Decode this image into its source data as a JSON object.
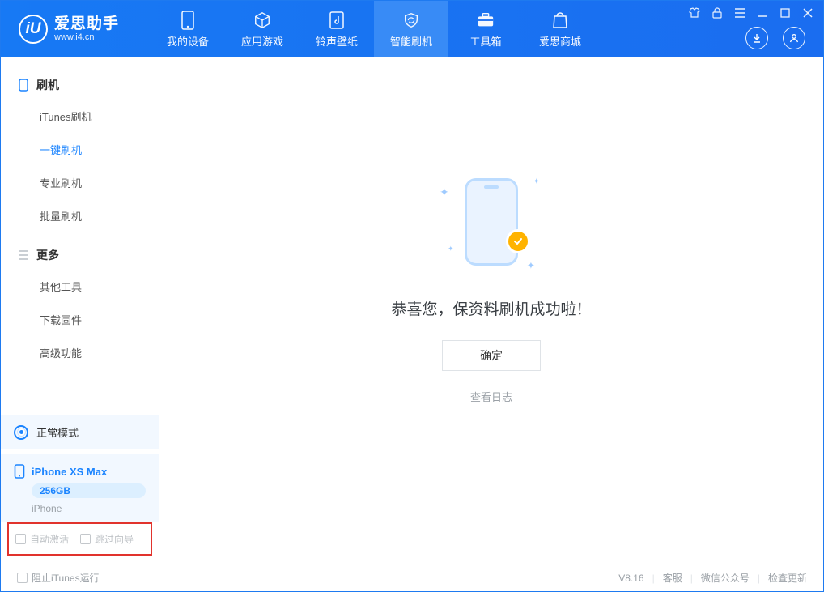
{
  "brand": {
    "name": "爱思助手",
    "url": "www.i4.cn",
    "logo_letter": "iU"
  },
  "nav": {
    "tabs": [
      {
        "label": "我的设备"
      },
      {
        "label": "应用游戏"
      },
      {
        "label": "铃声壁纸"
      },
      {
        "label": "智能刷机"
      },
      {
        "label": "工具箱"
      },
      {
        "label": "爱思商城"
      }
    ]
  },
  "sidebar": {
    "section_flash": "刷机",
    "items_flash": [
      {
        "label": "iTunes刷机"
      },
      {
        "label": "一键刷机"
      },
      {
        "label": "专业刷机"
      },
      {
        "label": "批量刷机"
      }
    ],
    "section_more": "更多",
    "items_more": [
      {
        "label": "其他工具"
      },
      {
        "label": "下载固件"
      },
      {
        "label": "高级功能"
      }
    ],
    "mode_label": "正常模式",
    "device": {
      "name": "iPhone XS Max",
      "storage": "256GB",
      "platform": "iPhone"
    },
    "chk_auto_activate": "自动激活",
    "chk_skip_guide": "跳过向导"
  },
  "main": {
    "success_title": "恭喜您，保资料刷机成功啦！",
    "ok_label": "确定",
    "log_link": "查看日志"
  },
  "status": {
    "block_itunes": "阻止iTunes运行",
    "version": "V8.16",
    "link_kefu": "客服",
    "link_wechat": "微信公众号",
    "link_update": "检查更新"
  }
}
